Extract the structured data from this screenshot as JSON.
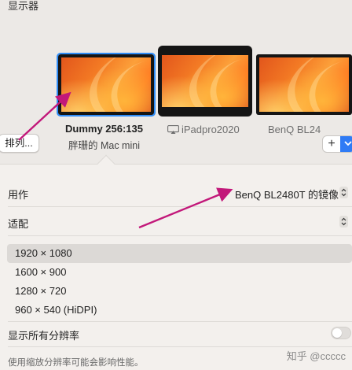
{
  "header": {
    "title": "显示器"
  },
  "displays": [
    {
      "name": "Dummy 256:135",
      "subtitle": "胖珊的 Mac mini",
      "selected": true
    },
    {
      "name": "iPadpro2020",
      "icon": "airplay-icon"
    },
    {
      "name": "BenQ BL24"
    }
  ],
  "buttons": {
    "arrange": "排列...",
    "add": "+"
  },
  "settings": {
    "use_as_label": "用作",
    "use_as_value": "BenQ BL2480T 的镜像",
    "fit_label": "适配",
    "resolutions": [
      "1920 × 1080",
      "1600 × 900",
      "1280 × 720",
      "960 × 540 (HiDPI)"
    ],
    "selected_resolution": "1920 × 1080",
    "show_all_label": "显示所有分辨率",
    "show_all_on": false,
    "footnote": "使用缩放分辨率可能会影响性能。"
  },
  "watermark": "知乎 @ccccc",
  "colors": {
    "accent": "#2f7bf5",
    "annotation_arrow": "#c2187a"
  }
}
